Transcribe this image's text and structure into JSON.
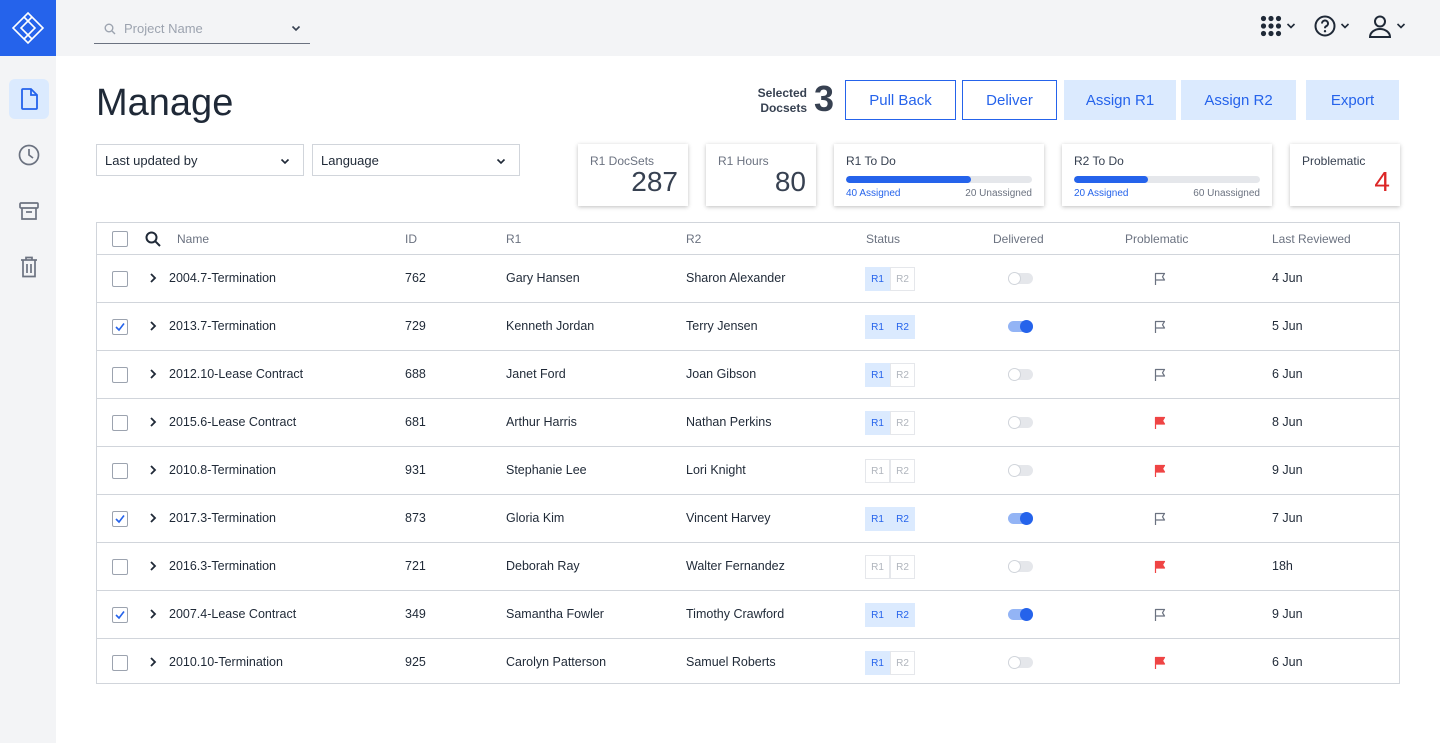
{
  "topbar": {
    "project_placeholder": "Project Name"
  },
  "icons": {
    "logo": "diamond-logo-icon",
    "search": "search-icon",
    "apps": "apps-grid-icon",
    "help": "help-circle-icon",
    "user": "user-icon",
    "chevron": "chevron-down-icon"
  },
  "sidebar": {
    "items": [
      "documents-icon",
      "history-clock-icon",
      "archive-icon",
      "trash-icon"
    ]
  },
  "header": {
    "title": "Manage",
    "selected_label_1": "Selected",
    "selected_label_2": "Docsets",
    "selected_count": "3",
    "buttons": {
      "pull_back": "Pull Back",
      "deliver": "Deliver",
      "assign_r1": "Assign R1",
      "assign_r2": "Assign R2",
      "export": "Export"
    }
  },
  "filters": {
    "last_updated_by": "Last updated by",
    "language": "Language"
  },
  "stats": {
    "r1_docsets": {
      "label": "R1 DocSets",
      "value": "287"
    },
    "r1_hours": {
      "label": "R1 Hours",
      "value": "80"
    },
    "r1_todo": {
      "label": "R1 To Do",
      "assigned": "40 Assigned",
      "unassigned": "20 Unassigned",
      "progress": 0.67
    },
    "r2_todo": {
      "label": "R2 To Do",
      "assigned": "20 Assigned",
      "unassigned": "60 Unassigned",
      "progress": 0.4
    },
    "problematic": {
      "label": "Problematic",
      "value": "4"
    }
  },
  "colors": {
    "accent": "#2563eb",
    "accent_soft": "#dbeafe",
    "danger": "#dc2626",
    "flag_red": "#ef4444"
  },
  "table": {
    "headers": {
      "name": "Name",
      "id": "ID",
      "r1": "R1",
      "r2": "R2",
      "status": "Status",
      "delivered": "Delivered",
      "problematic": "Problematic",
      "last_reviewed": "Last Reviewed"
    },
    "status_labels": {
      "r1": "R1",
      "r2": "R2"
    },
    "rows": [
      {
        "checked": false,
        "name": "2004.7-Termination",
        "id": "762",
        "r1": "Gary Hansen",
        "r2": "Sharon Alexander",
        "r1_done": true,
        "r2_done": false,
        "delivered": false,
        "problematic": false,
        "last_reviewed": "4 Jun"
      },
      {
        "checked": true,
        "name": "2013.7-Termination",
        "id": "729",
        "r1": "Kenneth Jordan",
        "r2": "Terry Jensen",
        "r1_done": true,
        "r2_done": true,
        "delivered": true,
        "problematic": false,
        "last_reviewed": "5 Jun"
      },
      {
        "checked": false,
        "name": "2012.10-Lease Contract",
        "id": "688",
        "r1": "Janet Ford",
        "r2": "Joan Gibson",
        "r1_done": true,
        "r2_done": false,
        "delivered": false,
        "problematic": false,
        "last_reviewed": "6 Jun"
      },
      {
        "checked": false,
        "name": "2015.6-Lease Contract",
        "id": "681",
        "r1": "Arthur Harris",
        "r2": "Nathan Perkins",
        "r1_done": true,
        "r2_done": false,
        "delivered": false,
        "problematic": true,
        "last_reviewed": "8 Jun"
      },
      {
        "checked": false,
        "name": "2010.8-Termination",
        "id": "931",
        "r1": "Stephanie Lee",
        "r2": "Lori Knight",
        "r1_done": false,
        "r2_done": false,
        "delivered": false,
        "problematic": true,
        "last_reviewed": "9 Jun"
      },
      {
        "checked": true,
        "name": "2017.3-Termination",
        "id": "873",
        "r1": "Gloria Kim",
        "r2": "Vincent Harvey",
        "r1_done": true,
        "r2_done": true,
        "delivered": true,
        "problematic": false,
        "last_reviewed": "7 Jun"
      },
      {
        "checked": false,
        "name": "2016.3-Termination",
        "id": "721",
        "r1": "Deborah Ray",
        "r2": "Walter Fernandez",
        "r1_done": false,
        "r2_done": false,
        "delivered": false,
        "problematic": true,
        "last_reviewed": "18h"
      },
      {
        "checked": true,
        "name": "2007.4-Lease Contract",
        "id": "349",
        "r1": "Samantha Fowler",
        "r2": "Timothy Crawford",
        "r1_done": true,
        "r2_done": true,
        "delivered": true,
        "problematic": false,
        "last_reviewed": "9 Jun"
      },
      {
        "checked": false,
        "name": "2010.10-Termination",
        "id": "925",
        "r1": "Carolyn Patterson",
        "r2": "Samuel Roberts",
        "r1_done": true,
        "r2_done": false,
        "delivered": false,
        "problematic": true,
        "last_reviewed": "6 Jun"
      }
    ]
  }
}
